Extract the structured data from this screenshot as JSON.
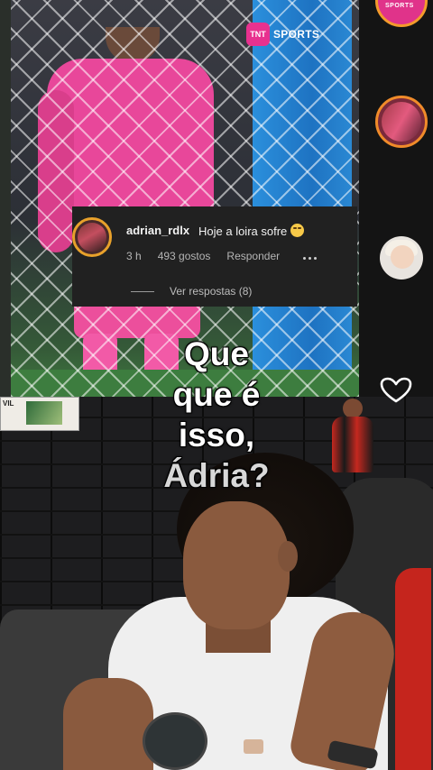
{
  "video_overlay": {
    "channel_logo": {
      "badge": "TNT",
      "text": "SPORTS"
    },
    "top_avatar_label": "SPORTS",
    "colors": {
      "net_post": "#1e73c2",
      "keeper_kit": "#e8479a",
      "avatar_ring": "#f08b2a"
    }
  },
  "comment": {
    "username": "adrian_rdlx",
    "text": "Hoje a loira sofre",
    "emoji": "laughing-face",
    "time": "3 h",
    "likes": "493 gostos",
    "reply": "Responder",
    "see_replies": "Ver respostas (8)"
  },
  "caption": {
    "lines": [
      "Que",
      "que é",
      "isso,",
      "Ádria?"
    ]
  },
  "poster": {
    "text": "VIL"
  },
  "icons": {
    "more": "more-dots-icon",
    "like": "heart-icon"
  }
}
